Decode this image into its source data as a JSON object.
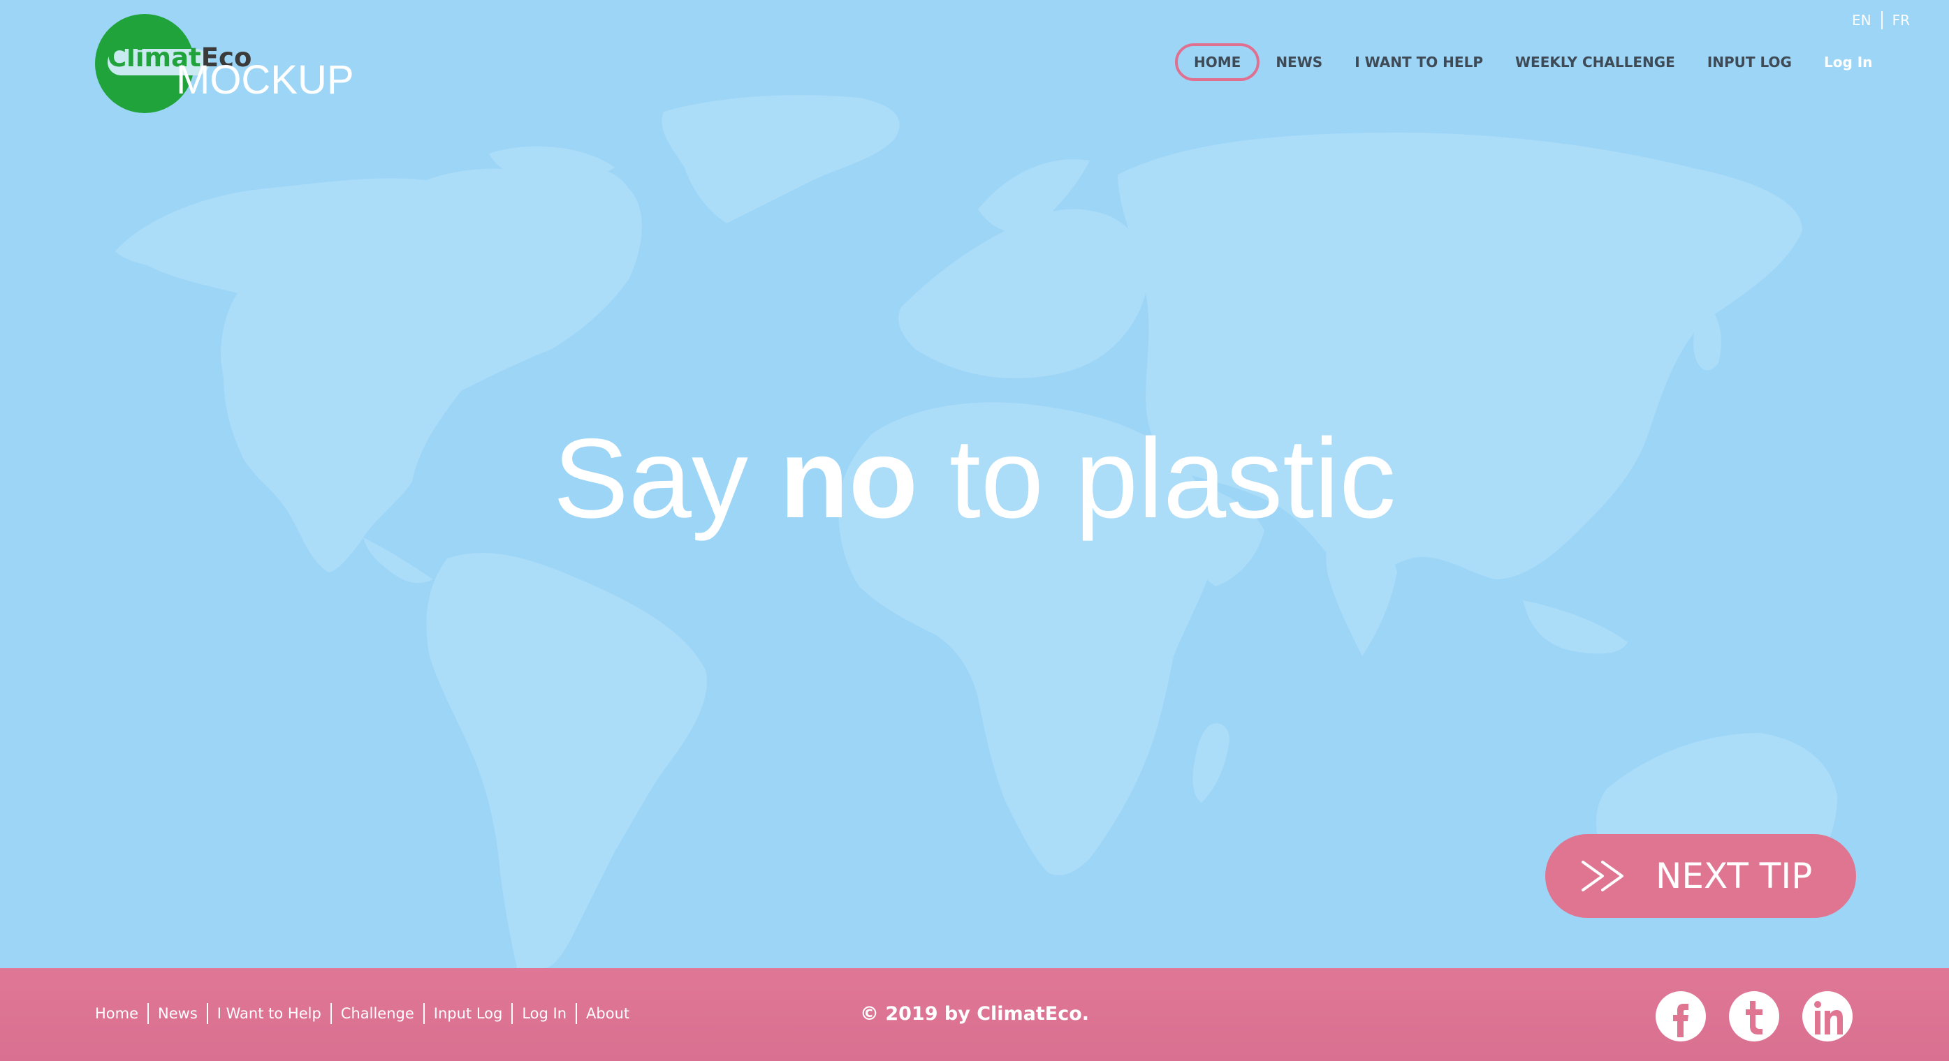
{
  "logo": {
    "brand_green": "Climat",
    "brand_dark": "Eco",
    "overlay": "MOCKUP"
  },
  "lang": {
    "en": "EN",
    "fr": "FR"
  },
  "nav": {
    "items": [
      {
        "label": "HOME",
        "active": true
      },
      {
        "label": "NEWS",
        "active": false
      },
      {
        "label": "I WANT TO HELP",
        "active": false
      },
      {
        "label": "WEEKLY CHALLENGE",
        "active": false
      },
      {
        "label": "INPUT LOG",
        "active": false
      },
      {
        "label": "Log In",
        "active": false
      }
    ]
  },
  "hero": {
    "headline_before": "Say ",
    "headline_bold": "no",
    "headline_after": " to plastic",
    "next_tip_label": "NEXT TIP",
    "next_tip_icon": "double-chevron-right-icon"
  },
  "footer": {
    "links": [
      "Home",
      "News",
      "I Want to Help",
      "Challenge",
      "Input Log",
      "Log In",
      "About"
    ],
    "copyright": "© 2019 by ClimatEco.",
    "social": [
      "facebook-icon",
      "twitter-icon",
      "linkedin-icon"
    ]
  },
  "colors": {
    "sky": "#9dd5f7",
    "map": "#abdcf8",
    "accent_pink": "#e07592",
    "brand_green": "#21a33b",
    "nav_text": "#3e4a55"
  }
}
